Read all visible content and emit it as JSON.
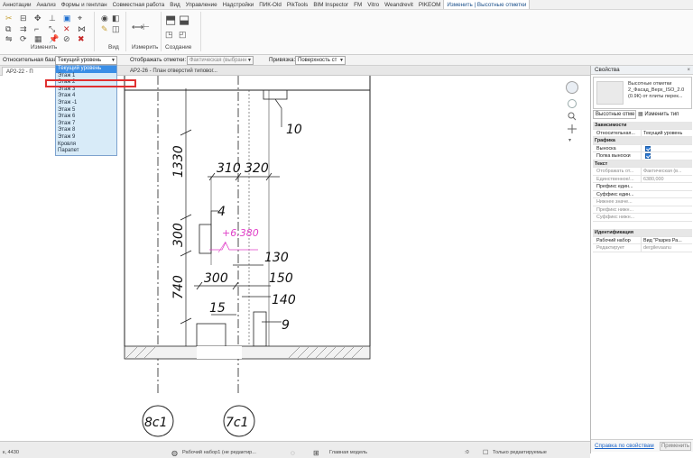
{
  "ribbon": {
    "tabs": [
      "Аннотации",
      "Анализ",
      "Формы и генплан",
      "Совместная работа",
      "Вид",
      "Управление",
      "Надстройки",
      "ПИК-Old",
      "PikTools",
      "BIM Inspector",
      "FM",
      "Vitro",
      "Weandrevit",
      "PIKEOM",
      "Изменить | Высотные отметки"
    ],
    "active_tab_index": 14,
    "groups": {
      "modify": "Изменить",
      "view": "Вид",
      "measure": "Измерить",
      "create": "Создание"
    }
  },
  "options": {
    "relative_base_label": "Относительная база:",
    "relative_base_value": "Текущий уровень",
    "display_label": "Отображать отметки:",
    "display_value": "Фактическая (выбранн",
    "snap_label": "Привязка:",
    "snap_value": "Поверхность ст"
  },
  "view_tabs": [
    "АР2-22 - П",
    "АР2-26 - План отверстий типовог..."
  ],
  "dropdown": {
    "items": [
      "Текущий уровень",
      "Этаж 1",
      "Этаж 2",
      "Этаж 3",
      "Этаж 4",
      "Этаж -1",
      "Этаж 5",
      "Этаж 6",
      "Этаж 7",
      "Этаж 8",
      "Этаж 9",
      "Кровля",
      "Парапет"
    ],
    "selected_index": 0,
    "highlighted_index": 2
  },
  "drawing": {
    "dimensions": [
      "1330",
      "310",
      "320",
      "300",
      "4",
      "740",
      "300",
      "150",
      "130",
      "140",
      "15",
      "10",
      "9"
    ],
    "elevation": "+6.380",
    "grid_labels": [
      "8с1",
      "7с1"
    ]
  },
  "properties": {
    "title": "Свойства",
    "close": "×",
    "type_name": "Высотные отметки 2_Фасад_Верх_ISO_2.0 (0.9К) от плиты перек...",
    "instance_label": "Высотные отме",
    "edit_type": "Изменить тип",
    "rows": [
      {
        "kind": "section",
        "k": "Зависимости"
      },
      {
        "kind": "row",
        "k": "Относительная...",
        "v": "Текущий уровень"
      },
      {
        "kind": "section",
        "k": "Графика"
      },
      {
        "kind": "check",
        "k": "Выноска"
      },
      {
        "kind": "check",
        "k": "Полка выноски"
      },
      {
        "kind": "section",
        "k": "Текст"
      },
      {
        "kind": "grey",
        "k": "Отображать от...",
        "v": "Фактическая (в..."
      },
      {
        "kind": "grey",
        "k": "Единственное/...",
        "v": "6380,000"
      },
      {
        "kind": "row",
        "k": "Префикс един...",
        "v": ""
      },
      {
        "kind": "row",
        "k": "Суффикс един...",
        "v": ""
      },
      {
        "kind": "grey",
        "k": "Нижнее значе...",
        "v": ""
      },
      {
        "kind": "grey",
        "k": "Префикс нижн...",
        "v": ""
      },
      {
        "kind": "grey",
        "k": "Суффикс нижн...",
        "v": ""
      },
      {
        "kind": "section",
        "k": "Идентификация"
      },
      {
        "kind": "row",
        "k": "Рабочий набор",
        "v": "Вид \"Разрез Ра..."
      },
      {
        "kind": "grey",
        "k": "Редактирует",
        "v": "dergilevaanu"
      }
    ],
    "help_link": "Справка по свойствам",
    "apply": "Применить"
  },
  "status": {
    "left": "к, 4430",
    "workset": "Рабочий набор1 (не редактир...",
    "model": "Главная модель",
    "zero": ":0",
    "right": "Только редактируемые"
  },
  "colors": {
    "accent": "#3a8ee6",
    "highlight": "#e03131",
    "elevation": "#e040c8"
  }
}
